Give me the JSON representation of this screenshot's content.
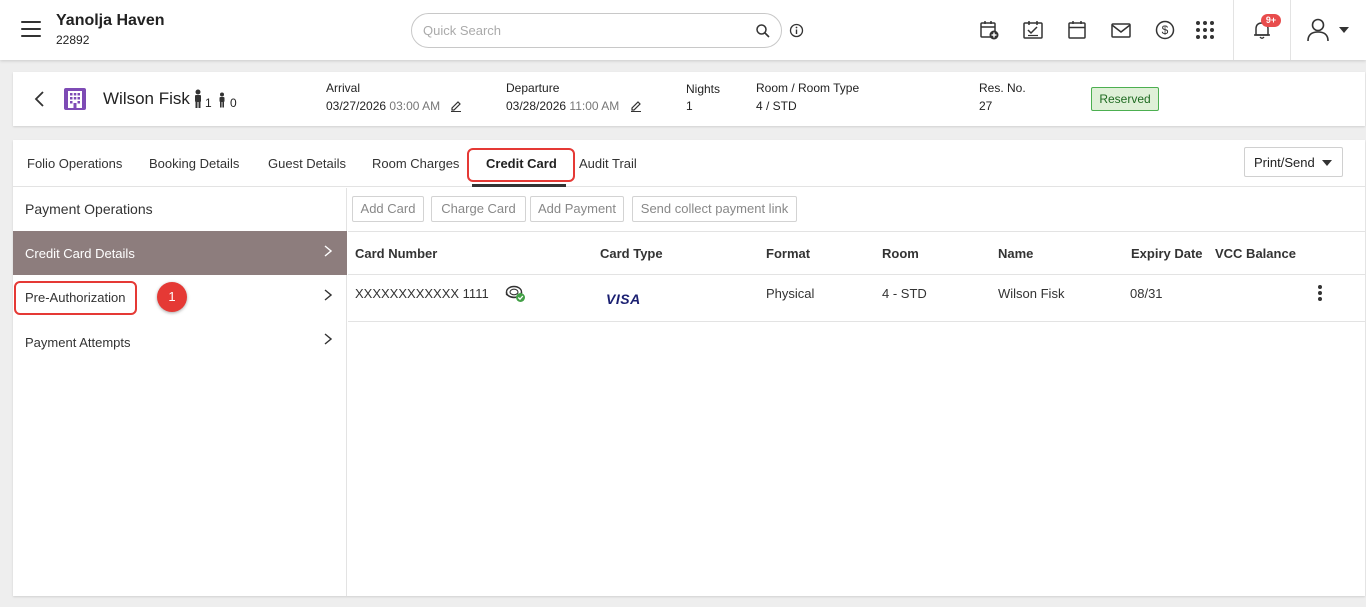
{
  "topbar": {
    "property_name": "Yanolja Haven",
    "property_id": "22892",
    "search_placeholder": "Quick Search",
    "notification_count": "9+",
    "icons": [
      "hamburger-menu-icon",
      "search-icon",
      "info-icon",
      "calendar-add-icon",
      "calendar-check-icon",
      "calendar-icon",
      "mail-icon",
      "dollar-icon",
      "apps-grid-icon",
      "bell-icon",
      "user-icon"
    ]
  },
  "reservation": {
    "guest_name": "Wilson Fisk",
    "adults": "1",
    "children": "0",
    "arrival_label": "Arrival",
    "arrival_date": "03/27/2026",
    "arrival_time": "03:00 AM",
    "departure_label": "Departure",
    "departure_date": "03/28/2026",
    "departure_time": "11:00 AM",
    "nights_label": "Nights",
    "nights": "1",
    "room_label": "Room / Room Type",
    "room": "4 / STD",
    "resno_label": "Res. No.",
    "resno": "27",
    "status": "Reserved",
    "status_color": "#4caf50"
  },
  "tabs": [
    {
      "label": "Folio Operations"
    },
    {
      "label": "Booking Details"
    },
    {
      "label": "Guest Details"
    },
    {
      "label": "Room Charges"
    },
    {
      "label": "Credit Card"
    },
    {
      "label": "Audit Trail"
    }
  ],
  "active_tab": "Credit Card",
  "print_send": "Print/Send",
  "sidebar": {
    "title": "Payment Operations",
    "items": [
      {
        "label": "Credit Card Details"
      },
      {
        "label": "Pre-Authorization"
      },
      {
        "label": "Payment Attempts"
      }
    ]
  },
  "annotation": {
    "step": "1",
    "highlight_color": "#e53935"
  },
  "actions": {
    "add_card": "Add Card",
    "charge_card": "Charge Card",
    "add_payment": "Add Payment",
    "send_link": "Send collect payment link"
  },
  "table": {
    "headers": [
      "Card Number",
      "Card Type",
      "Format",
      "Room",
      "Name",
      "Expiry Date",
      "VCC Balance"
    ],
    "rows": [
      {
        "card_number": "XXXXXXXXXXXX 1111",
        "card_type": "VISA",
        "format": "Physical",
        "room": "4 - STD",
        "name": "Wilson Fisk",
        "expiry": "08/31",
        "vcc_balance": ""
      }
    ]
  },
  "colors": {
    "active_sidebar_bg": "#8d7d7d",
    "badge_red": "#e84c4c",
    "visa_blue": "#1a1f71"
  }
}
